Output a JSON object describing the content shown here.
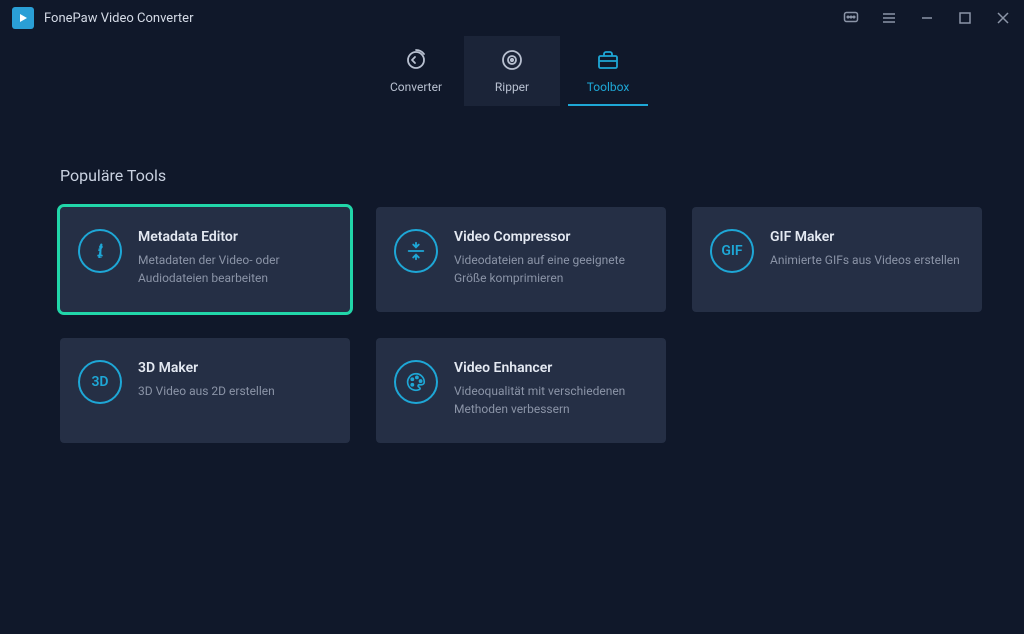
{
  "app": {
    "title": "FonePaw Video Converter"
  },
  "tabs": {
    "converter": "Converter",
    "ripper": "Ripper",
    "toolbox": "Toolbox"
  },
  "section": {
    "title": "Populäre Tools"
  },
  "tools": {
    "metadata": {
      "title": "Metadata Editor",
      "desc": "Metadaten der Video- oder Audiodateien bearbeiten"
    },
    "compressor": {
      "title": "Video Compressor",
      "desc": "Videodateien auf eine geeignete Größe komprimieren"
    },
    "gif": {
      "title": "GIF Maker",
      "desc": "Animierte GIFs aus Videos erstellen",
      "iconText": "GIF"
    },
    "threeD": {
      "title": "3D Maker",
      "desc": "3D Video aus 2D erstellen",
      "iconText": "3D"
    },
    "enhancer": {
      "title": "Video Enhancer",
      "desc": "Videoqualität mit verschiedenen Methoden verbessern"
    }
  }
}
